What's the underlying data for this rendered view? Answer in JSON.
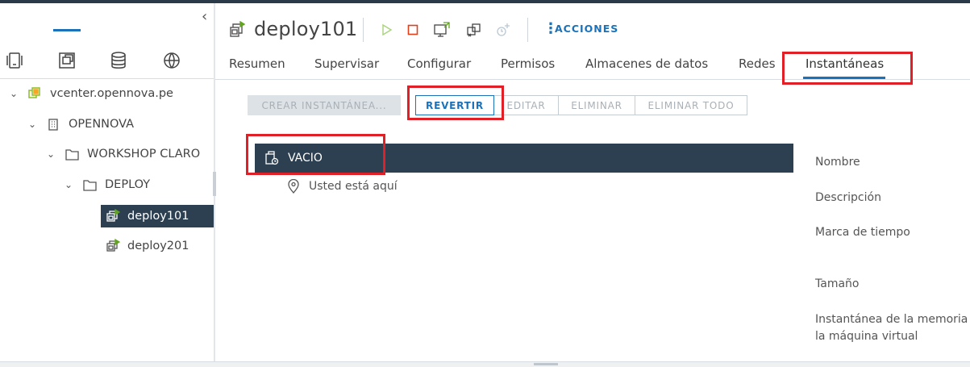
{
  "sidebar": {
    "tree": {
      "vcenter": "vcenter.opennova.pe",
      "datacenter": "OPENNOVA",
      "folder1": "WORKSHOP CLARO",
      "folder2": "DEPLOY",
      "vm1": "deploy101",
      "vm2": "deploy201"
    }
  },
  "header": {
    "vm_name": "deploy101",
    "actions_label": "ACCIONES"
  },
  "tabs": [
    "Resumen",
    "Supervisar",
    "Configurar",
    "Permisos",
    "Almacenes de datos",
    "Redes",
    "Instantáneas"
  ],
  "toolbar": {
    "crear": "CREAR INSTANTÁNEA...",
    "revertir": "REVERTIR",
    "editar": "EDITAR",
    "eliminar": "ELIMINAR",
    "eliminar_todo": "ELIMINAR TODO"
  },
  "snapshots": {
    "selected": "VACIO",
    "you_are_here": "Usted está aquí"
  },
  "details": {
    "nombre": "Nombre",
    "descripcion": "Descripción",
    "marca": "Marca de tiempo",
    "tamano": "Tamaño",
    "memoria_line1": "Instantánea de la memoria d",
    "memoria_line2": "la máquina virtual"
  },
  "colors": {
    "accent": "#1b72b8",
    "selected_bg": "#2c4052",
    "annotation": "#e01f26"
  }
}
